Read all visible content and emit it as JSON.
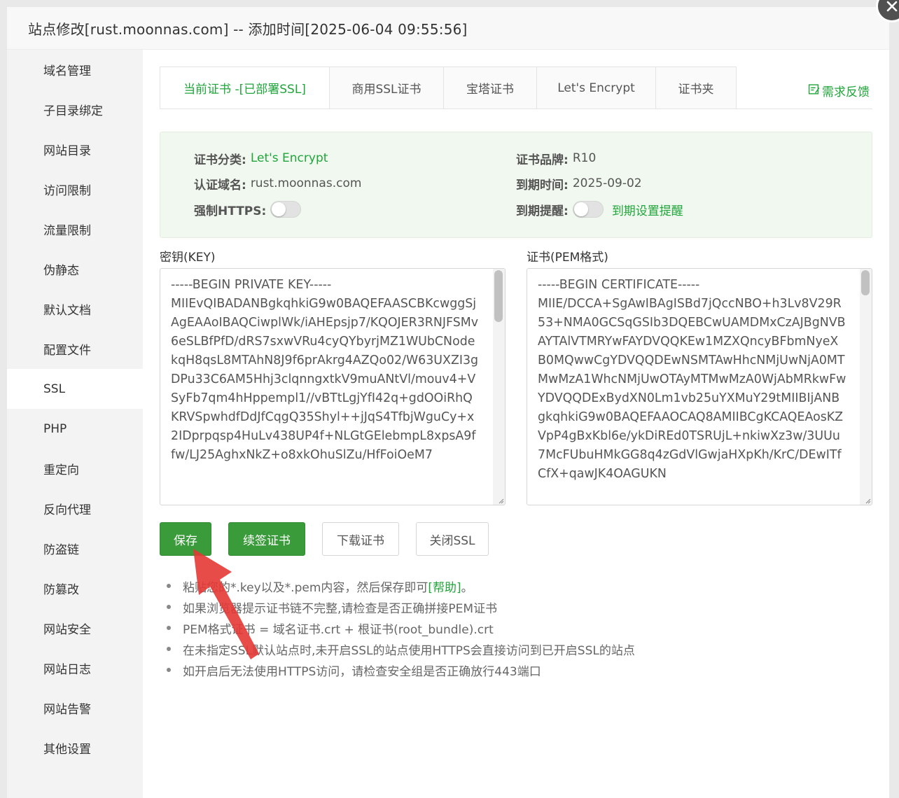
{
  "dialog": {
    "title": "站点修改[rust.moonnas.com] -- 添加时间[2025-06-04 09:55:56]"
  },
  "sidebar": {
    "items": [
      {
        "label": "域名管理"
      },
      {
        "label": "子目录绑定"
      },
      {
        "label": "网站目录"
      },
      {
        "label": "访问限制"
      },
      {
        "label": "流量限制"
      },
      {
        "label": "伪静态"
      },
      {
        "label": "默认文档"
      },
      {
        "label": "配置文件"
      },
      {
        "label": "SSL",
        "active": true
      },
      {
        "label": "PHP"
      },
      {
        "label": "重定向"
      },
      {
        "label": "反向代理"
      },
      {
        "label": "防盗链"
      },
      {
        "label": "防篡改"
      },
      {
        "label": "网站安全"
      },
      {
        "label": "网站日志"
      },
      {
        "label": "网站告警"
      },
      {
        "label": "其他设置"
      }
    ]
  },
  "tabs": [
    {
      "label": "当前证书 -[已部署SSL]",
      "active": true
    },
    {
      "label": "商用SSL证书"
    },
    {
      "label": "宝塔证书"
    },
    {
      "label": "Let's Encrypt"
    },
    {
      "label": "证书夹"
    }
  ],
  "feedback_label": "需求反馈",
  "cert_info": {
    "category_label": "证书分类:",
    "category_value": "Let's Encrypt",
    "brand_label": "证书品牌:",
    "brand_value": "R10",
    "domain_label": "认证域名:",
    "domain_value": "rust.moonnas.com",
    "expire_label": "到期时间:",
    "expire_value": "2025-09-02",
    "https_label": "强制HTTPS:",
    "https_enabled": false,
    "remind_label": "到期提醒:",
    "remind_enabled": false,
    "remind_link": "到期设置提醒"
  },
  "key_field": {
    "label": "密钥(KEY)",
    "value": "-----BEGIN PRIVATE KEY-----\nMIIEvQIBADANBgkqhkiG9w0BAQEFAASCBKcwggSjAgEAAoIBAQCiwplWk/iAHEpsjp7/KQOJER3RNJFSMv6eSLBfPfD/dRS7sxwVRu4cyQYbyrjMZ1WUbCNodekqH8qsL8MTAhN8J9f6prAkrg4AZQo02/W63UXZI3gDPu33C6AM5Hhj3clqnngxtkV9muANtVl/mouv4+VSyFb7qm4hHppempl1//vBTtLgjYfI42q+gdOOiRhQKRVSpwhdfDdJfCqgQ35Shyl++jJqS4TfbjWguCy+x2IDprpqsp4HuLv438UP4f+NLGtGElebmpL8xpsA9ffw/LJ25AghxNkZ+o8xkOhuSlZu/HfFoiOeM7"
  },
  "cert_field": {
    "label": "证书(PEM格式)",
    "value": "-----BEGIN CERTIFICATE-----\nMIIE/DCCA+SgAwIBAgISBd7jQccNBO+h3Lv8V29R53+NMA0GCSqGSIb3DQEBCwUAMDMxCzAJBgNVBAYTAlVTMRYwFAYDVQQKEw1MZXQncyBFbmNyeXB0MQwwCgYDVQQDEwNSMTAwHhcNMjUwNjA0MTMwMzA1WhcNMjUwOTAyMTMwMzA0WjAbMRkwFwYDVQQDExBydXN0Lm1vb25uYXMuY29tMIIBIjANBgkqhkiG9w0BAQEFAAOCAQ8AMIIBCgKCAQEAosKZVpP4gBxKbl6e/ykDiREd0TSRUjL+nkiwXz3w/3UUu7McFUbuHMkGG8q4zGdVlGwjaHXpKh/KrC/DEwITfCfX+qawJK4OAGUKN"
  },
  "buttons": {
    "save": "保存",
    "renew": "续签证书",
    "download": "下载证书",
    "close_ssl": "关闭SSL"
  },
  "tips": {
    "t1_prefix": "粘贴您的*.key以及*.pem内容，然后保存即可",
    "t1_link": "[帮助]",
    "t1_suffix": "。",
    "t2": "如果浏览器提示证书链不完整,请检查是否正确拼接PEM证书",
    "t3": "PEM格式证书 = 域名证书.crt + 根证书(root_bundle).crt",
    "t4": "在未指定SSL默认站点时,未开启SSL的站点使用HTTPS会直接访问到已开启SSL的站点",
    "t5": "如开启后无法使用HTTPS访问，请检查安全组是否正确放行443端口"
  },
  "colors": {
    "brand_green": "#20a53a",
    "button_green": "#3a9b3a",
    "annotation_arrow": "#e53935"
  }
}
